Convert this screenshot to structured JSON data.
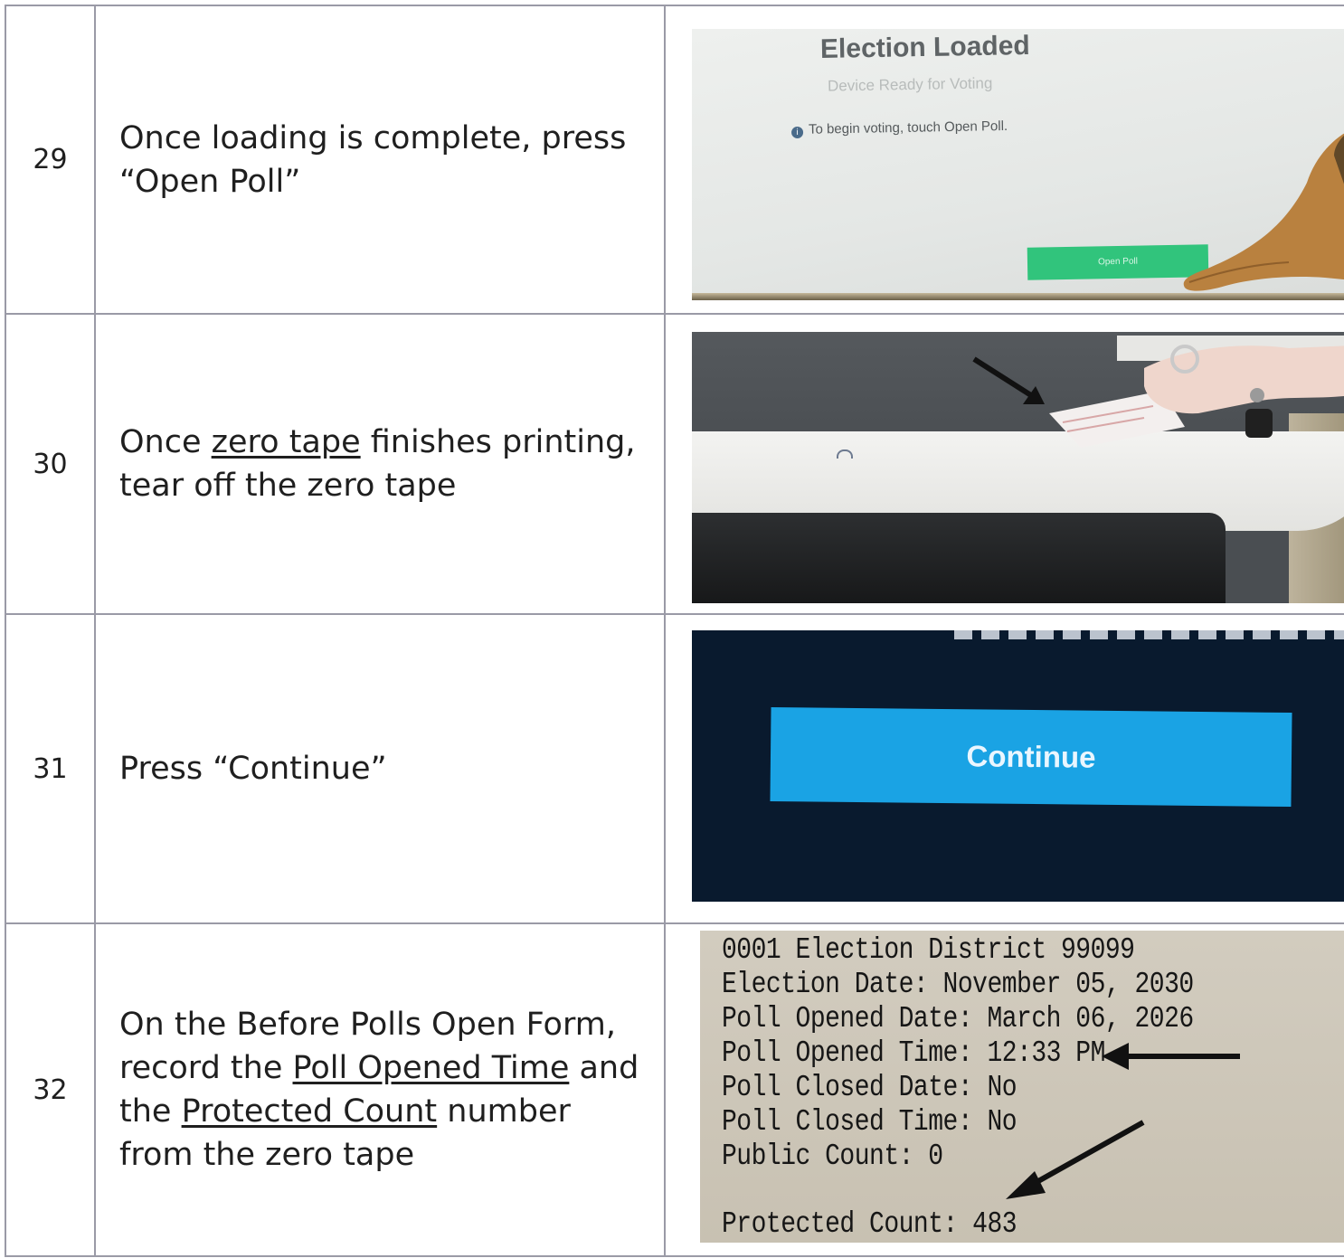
{
  "steps": [
    {
      "number": "29",
      "text": "Once loading is complete, press “Open Poll”",
      "photo": {
        "title": "Election Loaded",
        "subtitle": "Device Ready for Voting",
        "info_icon": "info-icon",
        "info": "To begin voting, touch Open Poll.",
        "button": "Open Poll"
      }
    },
    {
      "number": "30",
      "text_before": "Once ",
      "text_link": "zero tape",
      "text_after": " finishes printing, tear off the zero tape"
    },
    {
      "number": "31",
      "text": "Press “Continue”",
      "photo": {
        "button": "Continue"
      }
    },
    {
      "number": "32",
      "text_1": "On the Before Polls Open Form, record the ",
      "text_link_1": "Poll Opened Time",
      "text_2": " and the ",
      "text_link_2": "Protected Count",
      "text_3": " number from the zero tape",
      "tape_lines": [
        "0001 Election District 99099",
        "Election Date: November 05, 2030",
        "Poll Opened Date: March 06, 2026",
        "Poll Opened Time: 12:33 PM",
        "Poll Closed Date: No",
        "Poll Closed Time: No",
        "Public Count: 0",
        "Protected Count: 483"
      ]
    }
  ]
}
